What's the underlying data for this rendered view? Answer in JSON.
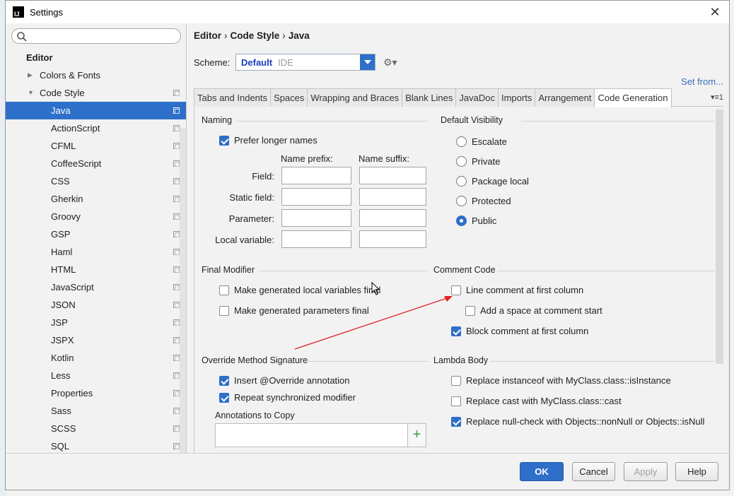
{
  "window": {
    "title": "Settings"
  },
  "search": {
    "placeholder": ""
  },
  "sidebar": {
    "section": "Editor",
    "items": [
      {
        "label": "Colors & Fonts"
      },
      {
        "label": "Code Style"
      },
      {
        "label": "Java"
      },
      {
        "label": "ActionScript"
      },
      {
        "label": "CFML"
      },
      {
        "label": "CoffeeScript"
      },
      {
        "label": "CSS"
      },
      {
        "label": "Gherkin"
      },
      {
        "label": "Groovy"
      },
      {
        "label": "GSP"
      },
      {
        "label": "Haml"
      },
      {
        "label": "HTML"
      },
      {
        "label": "JavaScript"
      },
      {
        "label": "JSON"
      },
      {
        "label": "JSP"
      },
      {
        "label": "JSPX"
      },
      {
        "label": "Kotlin"
      },
      {
        "label": "Less"
      },
      {
        "label": "Properties"
      },
      {
        "label": "Sass"
      },
      {
        "label": "SCSS"
      },
      {
        "label": "SQL"
      }
    ],
    "selected": "Java"
  },
  "breadcrumb": {
    "part1": "Editor",
    "part2": "Code Style",
    "part3": "Java",
    "separator": "›"
  },
  "scheme": {
    "label": "Scheme:",
    "value": "Default",
    "sub": "IDE"
  },
  "set_from": "Set from...",
  "tabs": [
    "Tabs and Indents",
    "Spaces",
    "Wrapping and Braces",
    "Blank Lines",
    "JavaDoc",
    "Imports",
    "Arrangement",
    "Code Generation"
  ],
  "active_tab": "Code Generation",
  "naming": {
    "title": "Naming",
    "prefer_longer": "Prefer longer names",
    "prefix_header": "Name prefix:",
    "suffix_header": "Name suffix:",
    "rows": [
      "Field:",
      "Static field:",
      "Parameter:",
      "Local variable:"
    ]
  },
  "default_visibility": {
    "title": "Default Visibility",
    "options": [
      "Escalate",
      "Private",
      "Package local",
      "Protected",
      "Public"
    ],
    "selected": "Public"
  },
  "final_modifier": {
    "title": "Final Modifier",
    "local_vars": "Make generated local variables final",
    "params": "Make generated parameters final"
  },
  "comment_code": {
    "title": "Comment Code",
    "line_comment": "Line comment at first column",
    "add_space": "Add a space at comment start",
    "block_comment": "Block comment at first column"
  },
  "override": {
    "title": "Override Method Signature",
    "insert_override": "Insert @Override annotation",
    "repeat_sync": "Repeat synchronized modifier",
    "annotations_to_copy": "Annotations to Copy"
  },
  "lambda": {
    "title": "Lambda Body",
    "instanceof": "Replace instanceof with MyClass.class::isInstance",
    "cast": "Replace cast with MyClass.class::cast",
    "nullcheck": "Replace null-check with Objects::nonNull or Objects::isNull"
  },
  "buttons": {
    "ok": "OK",
    "cancel": "Cancel",
    "apply": "Apply",
    "help": "Help"
  },
  "colors": {
    "accent": "#2e6fc9",
    "annotation_arrow": "#e02020",
    "link": "#3a6fb8"
  },
  "icons": {
    "search": "search-icon",
    "gear": "gear-icon",
    "close": "close-icon",
    "copy": "copy-icon",
    "add": "add-icon",
    "app": "intellij-icon"
  }
}
